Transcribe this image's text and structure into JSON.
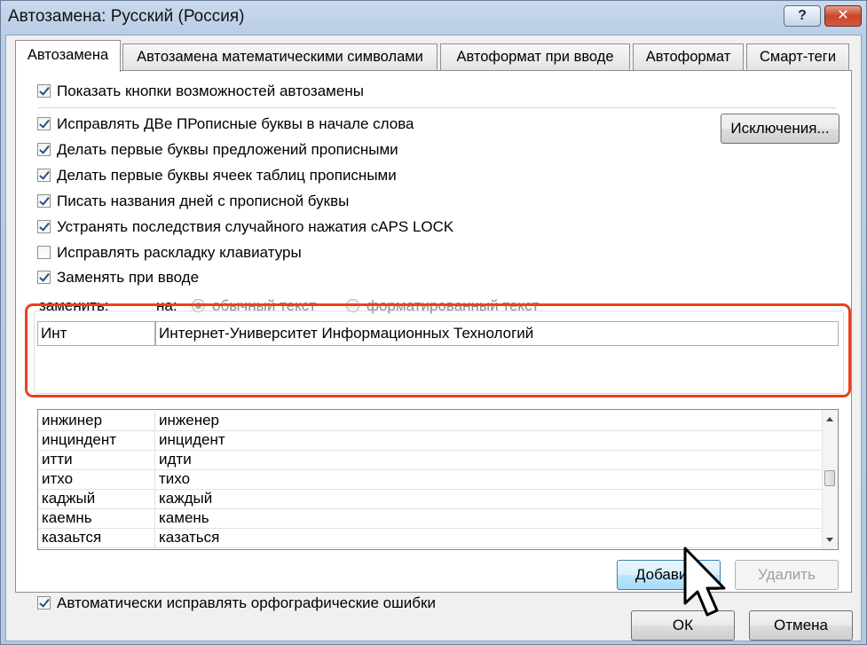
{
  "window": {
    "title": "Автозамена: Русский (Россия)",
    "help_label": "?",
    "close_label": "✕"
  },
  "tabs": [
    {
      "label": "Автозамена",
      "active": true
    },
    {
      "label": "Автозамена математическими символами",
      "active": false
    },
    {
      "label": "Автоформат при вводе",
      "active": false
    },
    {
      "label": "Автоформат",
      "active": false
    },
    {
      "label": "Смарт-теги",
      "active": false
    }
  ],
  "options": {
    "show_buttons": {
      "label": "Показать кнопки возможностей автозамены",
      "checked": true
    },
    "two_initial_caps": {
      "label": "Исправлять ДВе ПРописные буквы в начале слова",
      "checked": true
    },
    "capitalize_sentences": {
      "label": "Делать первые буквы предложений прописными",
      "checked": true
    },
    "capitalize_table_cells": {
      "label": "Делать первые буквы ячеек таблиц прописными",
      "checked": true
    },
    "capitalize_days": {
      "label": "Писать названия дней с прописной буквы",
      "checked": true
    },
    "caps_lock": {
      "label": "Устранять последствия случайного нажатия cAPS LOCK",
      "checked": true
    },
    "keyboard_layout": {
      "label": "Исправлять раскладку клавиатуры",
      "checked": false
    },
    "replace_as_you_type": {
      "label": "Заменять при вводе",
      "checked": true
    },
    "auto_spelling": {
      "label": "Автоматически исправлять орфографические ошибки",
      "checked": true
    }
  },
  "exceptions_button": "Исключения...",
  "replace": {
    "replace_label": "заменить:",
    "with_label": "на:",
    "plain_text": "обычный текст",
    "formatted_text": "форматированный текст",
    "replace_value": "Инт",
    "with_value": "Интернет-Университет Информационных Технологий"
  },
  "list": {
    "rows": [
      {
        "from": "инжинер",
        "to": "инженер"
      },
      {
        "from": "инциндент",
        "to": "инцидент"
      },
      {
        "from": "итти",
        "to": "идти"
      },
      {
        "from": "итхо",
        "to": "тихо"
      },
      {
        "from": "каджый",
        "to": "каждый"
      },
      {
        "from": "каемнь",
        "to": "камень"
      },
      {
        "from": "казаьтся",
        "to": "казаться"
      }
    ]
  },
  "buttons": {
    "add": "Добавить",
    "delete": "Удалить",
    "ok": "ОК",
    "cancel": "Отмена"
  }
}
